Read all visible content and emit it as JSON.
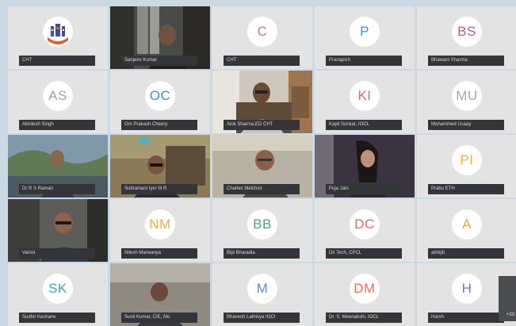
{
  "colors": {
    "background": "#cbd9e5",
    "tile": "#e3e3e3",
    "name_bar": "#333539",
    "avatar_text": {
      "C": "#e56f6f",
      "P": "#4a90d9",
      "BS": "#b25aa8",
      "AS": "#a0a0a0",
      "OC": "#3b8ec8",
      "KI": "#e06a5a",
      "MU": "#a6a6a6",
      "PI": "#e8b13a",
      "NM": "#e8b13a",
      "BB": "#47a87a",
      "DC": "#e06a5a",
      "A": "#e8a53a",
      "SK": "#3aa8a0",
      "M": "#4a90d9",
      "DM": "#e87050",
      "H": "#8f6ab0"
    }
  },
  "tiles": [
    {
      "name": "CHT",
      "kind": "logo"
    },
    {
      "name": "Sanjeev Kumar",
      "kind": "video"
    },
    {
      "name": "CHT",
      "kind": "avatar",
      "initials": "C"
    },
    {
      "name": "Pranapich",
      "kind": "avatar",
      "initials": "P"
    },
    {
      "name": "Bhawani Sharma",
      "kind": "avatar",
      "initials": "BS"
    },
    {
      "name": "Akhilesh Singh",
      "kind": "avatar",
      "initials": "AS"
    },
    {
      "name": "Om Prakash Cheery",
      "kind": "avatar",
      "initials": "OC"
    },
    {
      "name": "Alok Sharma,ED CHT",
      "kind": "video"
    },
    {
      "name": "Kapil Sonkar, IOCL",
      "kind": "avatar",
      "initials": "KI"
    },
    {
      "name": "Mohammed Usaay",
      "kind": "avatar",
      "initials": "MU"
    },
    {
      "name": "Dr R S Raman",
      "kind": "video"
    },
    {
      "name": "Subramani Iyer M R",
      "kind": "video"
    },
    {
      "name": "Charles Melchior",
      "kind": "video"
    },
    {
      "name": "Puja Jain",
      "kind": "video"
    },
    {
      "name": "Prabu ETH",
      "kind": "avatar",
      "initials": "PI"
    },
    {
      "name": "Vamsi",
      "kind": "video"
    },
    {
      "name": "Nilesh Marwanya",
      "kind": "avatar",
      "initials": "NM"
    },
    {
      "name": "Bipi Bharadia",
      "kind": "avatar",
      "initials": "BB"
    },
    {
      "name": "Dir Tech, CPCL",
      "kind": "avatar",
      "initials": "DC"
    },
    {
      "name": "abhijiit",
      "kind": "avatar",
      "initials": "A"
    },
    {
      "name": "Sudhir Kesharw",
      "kind": "avatar",
      "initials": "SK"
    },
    {
      "name": "Sunil Kumar, CIE, Mo",
      "kind": "video"
    },
    {
      "name": "Bhavesh Lathisya IOCI",
      "kind": "avatar",
      "initials": "M"
    },
    {
      "name": "Dr. S. Meenakshi, IOCL",
      "kind": "avatar",
      "initials": "DM"
    },
    {
      "name": "Harsh",
      "kind": "avatar",
      "initials": "H"
    }
  ],
  "side_panel": {
    "label": "+33"
  }
}
